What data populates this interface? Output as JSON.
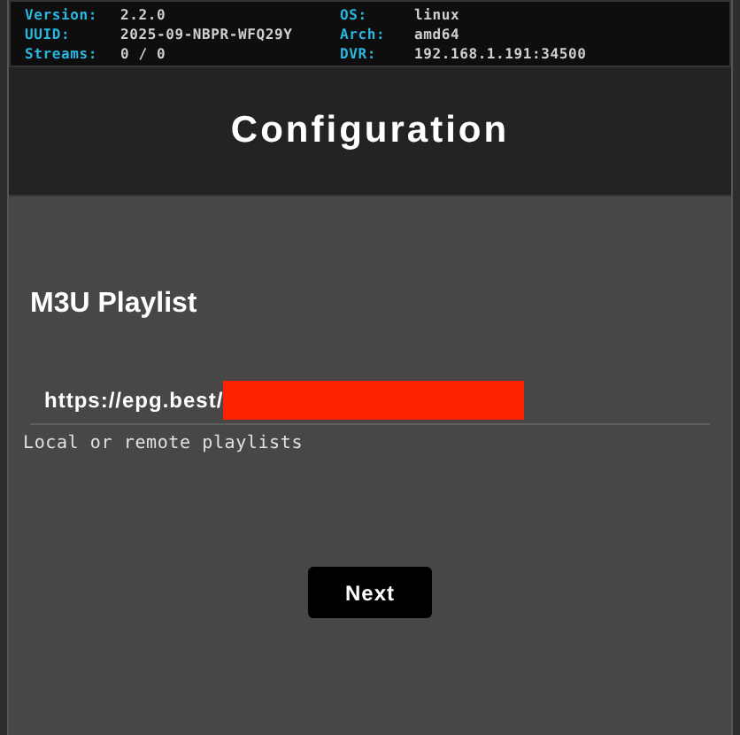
{
  "info": [
    {
      "label": "Version:",
      "value": "2.2.0"
    },
    {
      "label": "OS:",
      "value": "linux"
    },
    {
      "label": "UUID:",
      "value": "2025-09-NBPR-WFQ29Y"
    },
    {
      "label": "Arch:",
      "value": "amd64"
    },
    {
      "label": "Streams:",
      "value": "0 / 0"
    },
    {
      "label": "DVR:",
      "value": "192.168.1.191:34500"
    }
  ],
  "header": {
    "title": "Configuration"
  },
  "section": {
    "title": "M3U Playlist",
    "field": {
      "value": "https://epg.best/",
      "redacted": true
    },
    "hint": "Local or remote playlists"
  },
  "buttons": [
    "Next"
  ]
}
